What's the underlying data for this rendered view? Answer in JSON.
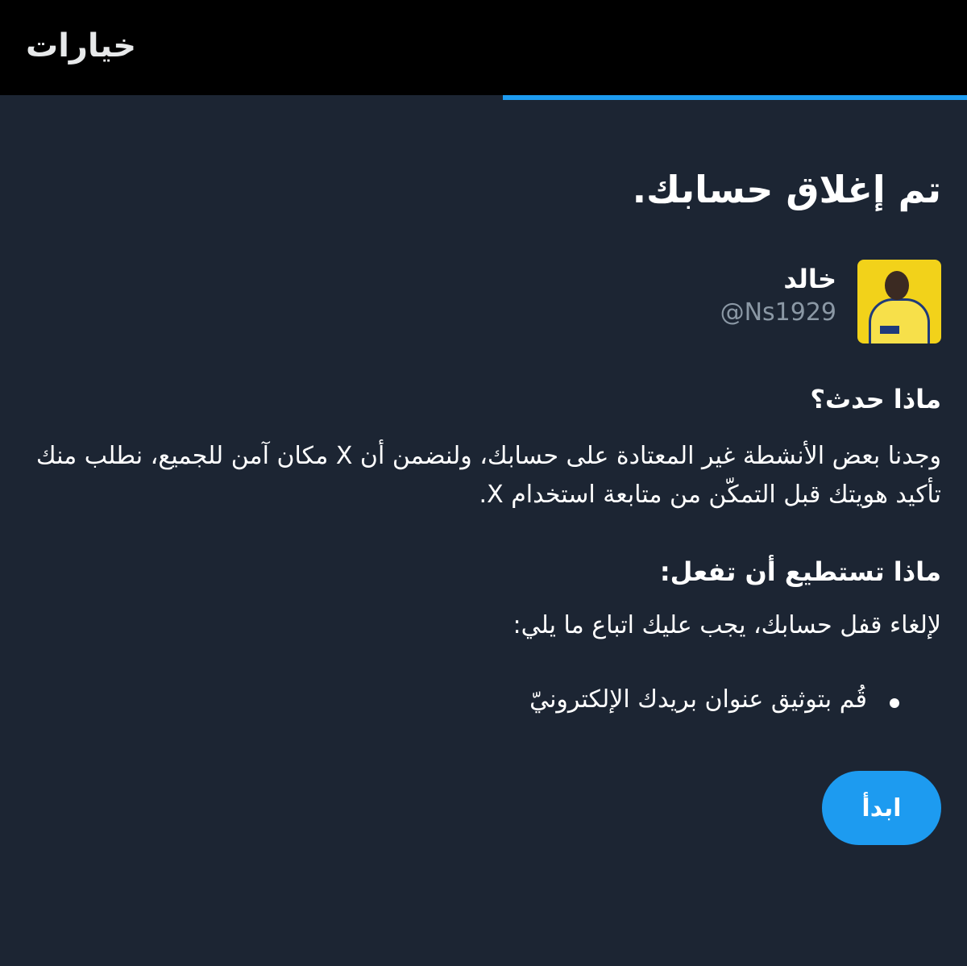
{
  "header": {
    "title": "خيارات"
  },
  "progress": {
    "fraction": 0.48,
    "color": "#1d9bf0"
  },
  "main": {
    "heading": "تم إغلاق حسابك.",
    "profile": {
      "display_name": "خالد",
      "handle": "@Ns1929"
    },
    "what_happened": {
      "title": "ماذا حدث؟",
      "body": "وجدنا بعض الأنشطة غير المعتادة على حسابك، ولنضمن أن X مكان آمن للجميع، نطلب منك تأكيد هويتك قبل التمكّن من متابعة استخدام X."
    },
    "what_you_can_do": {
      "title": "ماذا تستطيع أن تفعل:",
      "body": "لإلغاء قفل حسابك، يجب عليك اتباع ما يلي:",
      "steps": [
        "قُم بتوثيق عنوان بريدك الإلكترونيّ"
      ]
    },
    "start_button": "ابدأ"
  },
  "colors": {
    "background": "#1c2533",
    "header_background": "#000000",
    "accent": "#1d9bf0",
    "secondary_text": "#8b98a5"
  }
}
